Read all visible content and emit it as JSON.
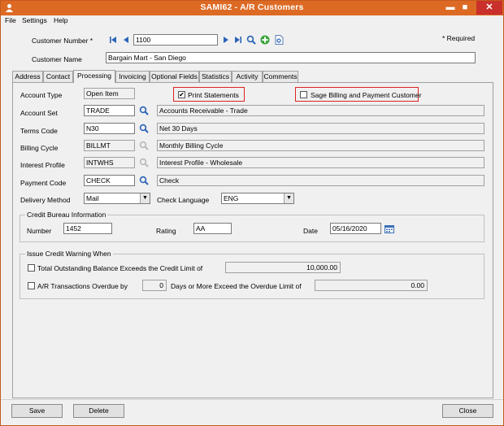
{
  "window": {
    "title": "SAMI62 - A/R Customers",
    "minimize": "▬",
    "maximize": "■",
    "close": "✕"
  },
  "menu": [
    "File",
    "Settings",
    "Help"
  ],
  "header": {
    "customer_number_label": "Customer Number *",
    "customer_number_value": "1100",
    "required_note": "*  Required",
    "customer_name_label": "Customer Name",
    "customer_name_value": "Bargain Mart - San Diego"
  },
  "tabs": [
    "Address",
    "Contact",
    "Processing",
    "Invoicing",
    "Optional Fields",
    "Statistics",
    "Activity",
    "Comments"
  ],
  "active_tab": "Processing",
  "processing": {
    "account_type_label": "Account Type",
    "account_type_value": "Open Item",
    "print_statements_label": "Print Statements",
    "print_statements_checked": true,
    "sage_billing_label": "Sage Billing and Payment Customer",
    "sage_billing_checked": false,
    "account_set_label": "Account Set",
    "account_set_code": "TRADE",
    "account_set_desc": "Accounts Receivable - Trade",
    "terms_code_label": "Terms Code",
    "terms_code": "N30",
    "terms_desc": "Net 30 Days",
    "billing_cycle_label": "Billing Cycle",
    "billing_cycle_code": "BILLMT",
    "billing_cycle_desc": "Monthly Billing Cycle",
    "interest_profile_label": "Interest Profile",
    "interest_profile_code": "INTWHS",
    "interest_profile_desc": "Interest Profile - Wholesale",
    "payment_code_label": "Payment Code",
    "payment_code": "CHECK",
    "payment_desc": "Check",
    "delivery_method_label": "Delivery Method",
    "delivery_method_value": "Mail",
    "check_language_label": "Check Language",
    "check_language_value": "ENG"
  },
  "credit_bureau": {
    "title": "Credit Bureau Information",
    "number_label": "Number",
    "number_value": "1452",
    "rating_label": "Rating",
    "rating_value": "AA",
    "date_label": "Date",
    "date_value": "05/16/2020"
  },
  "credit_warning": {
    "title": "Issue Credit Warning When",
    "total_outstanding_label": "Total Outstanding Balance Exceeds the Credit Limit of",
    "total_outstanding_checked": false,
    "credit_limit_value": "10,000.00",
    "overdue_label": "A/R Transactions Overdue by",
    "overdue_checked": false,
    "overdue_days": "0",
    "overdue_suffix": "Days or More Exceed the Overdue Limit of",
    "overdue_limit": "0.00"
  },
  "buttons": {
    "save": "Save",
    "delete": "Delete",
    "close": "Close"
  },
  "colors": {
    "titlebar": "#dd6a24",
    "highlight": "#dd2222"
  }
}
